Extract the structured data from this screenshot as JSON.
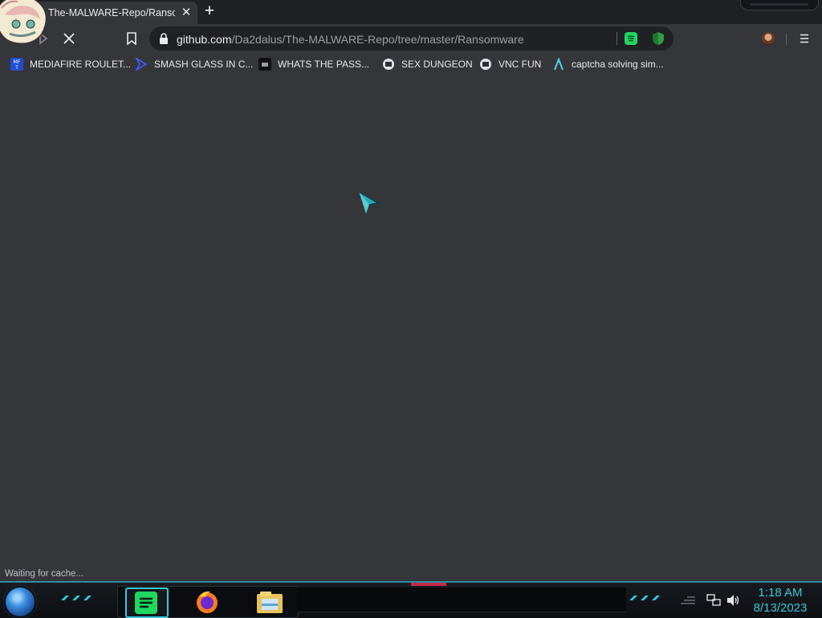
{
  "browser": {
    "tab": {
      "title": "The-MALWARE-Repo/Ransomware",
      "close_icon": "close-icon"
    },
    "new_tab_icon": "plus-icon",
    "toolbar": {
      "forward_icon": "forward-arrow-icon",
      "stop_icon": "close-icon",
      "bookmark_icon": "bookmark-icon"
    },
    "address_bar": {
      "host": "github.com",
      "path": "/Da2dalus/The-MALWARE-Repo/tree/master/Ransomware"
    },
    "bookmarks": [
      {
        "label": "MEDIAFIRE ROULET...",
        "icon": "mediafire-icon"
      },
      {
        "label": "SMASH GLASS IN C...",
        "icon": "chevron-brand-icon"
      },
      {
        "label": "WHATS THE PASS...",
        "icon": "dark-site-icon"
      },
      {
        "label": "SEX DUNGEON",
        "icon": "vnc-site-icon"
      },
      {
        "label": "VNC FUN",
        "icon": "vnc-site-icon"
      },
      {
        "label": "captcha solving sim...",
        "icon": "lambda-icon"
      }
    ]
  },
  "status_bar": {
    "text": "Waiting for cache..."
  },
  "taskbar": {
    "clock": {
      "time": "1:18 AM",
      "date": "8/13/2023"
    },
    "apps": [
      "spotify-icon",
      "firefox-icon",
      "file-explorer-icon"
    ]
  },
  "colors": {
    "chrome_bg": "#35363a",
    "tabstrip_bg": "#202124",
    "omnibox_bg": "#202124",
    "accent_cyan": "#36c9e0",
    "spotify_green": "#1ed760"
  }
}
